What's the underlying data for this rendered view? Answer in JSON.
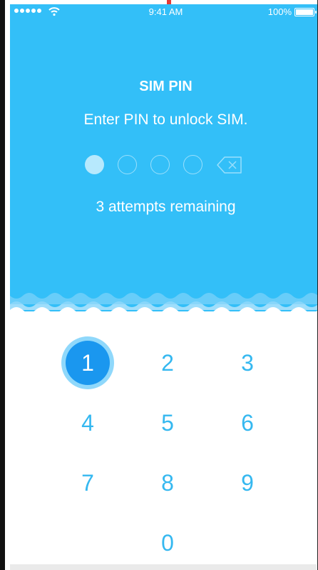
{
  "status_bar": {
    "time": "9:41 AM",
    "battery_percent_label": "100%",
    "battery_level": 1.0,
    "signal_icon": "signal-dots-icon",
    "wifi_icon": "wifi-icon"
  },
  "header": {
    "title": "SIM PIN",
    "subtitle": "Enter PIN to unlock SIM.",
    "attempts": "3 attempts remaining"
  },
  "pin": {
    "length": 4,
    "entered": 1,
    "backspace_icon": "backspace-icon"
  },
  "keypad": {
    "keys": [
      "1",
      "2",
      "3",
      "4",
      "5",
      "6",
      "7",
      "8",
      "9",
      "0"
    ],
    "active_key": "1"
  },
  "colors": {
    "accent": "#33bff8",
    "active_key": "#1a97ef",
    "key_text": "#35b8f0"
  }
}
